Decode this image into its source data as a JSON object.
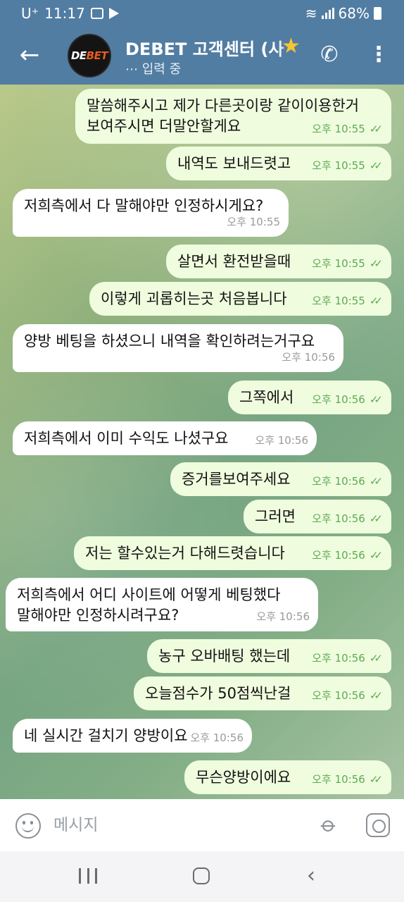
{
  "status_bar": {
    "carrier": "U⁺",
    "time": "11:17",
    "battery": "68%"
  },
  "header": {
    "back_icon": "arrow-left-icon",
    "avatar_text_a": "DE",
    "avatar_text_b": "BET",
    "title": "DEBET 고객센터 (사",
    "subtitle": "⋯ 입력 중",
    "star": "★",
    "call_icon": "phone-icon",
    "more_icon": "more-vertical-icon"
  },
  "messages": [
    {
      "dir": "out",
      "text": "말씀해주시고 제가 다른곳이랑 같이이용한거\n보여주시면 더말안할게요",
      "time": "오후 10:55"
    },
    {
      "dir": "out",
      "text": "내역도 보내드렷고",
      "time": "오후 10:55"
    },
    {
      "dir": "in",
      "text": "저희측에서 다 말해야만 인정하시게요?",
      "time": "오후 10:55"
    },
    {
      "dir": "out",
      "text": "살면서 환전받을때",
      "time": "오후 10:55"
    },
    {
      "dir": "out",
      "text": "이렇게 괴롭히는곳 처음봅니다",
      "time": "오후 10:55"
    },
    {
      "dir": "in",
      "text": "양방 베팅을 하셨으니 내역을 확인하려는거구요",
      "time": "오후 10:56"
    },
    {
      "dir": "out",
      "text": "그쪽에서",
      "time": "오후 10:56"
    },
    {
      "dir": "in",
      "text": "저희측에서 이미 수익도 나셨구요",
      "time": "오후 10:56"
    },
    {
      "dir": "out",
      "text": "증거를보여주세요",
      "time": "오후 10:56"
    },
    {
      "dir": "out",
      "text": "그러면",
      "time": "오후 10:56"
    },
    {
      "dir": "out",
      "text": "저는 할수있는거 다해드렷습니다",
      "time": "오후 10:56"
    },
    {
      "dir": "in",
      "text": "저희측에서 어디 사이트에 어떻게 베팅했다\n말해야만 인정하시려구요?",
      "time": "오후 10:56"
    },
    {
      "dir": "out",
      "text": "농구 오바배팅 했는데",
      "time": "오후 10:56"
    },
    {
      "dir": "out",
      "text": "오늘점수가 50점씩난걸",
      "time": "오후 10:56"
    },
    {
      "dir": "in",
      "text": "네 실시간 걸치기 양방이요",
      "time": "오후 10:56"
    },
    {
      "dir": "out",
      "text": "무슨양방이에요",
      "time": "오후 10:56"
    }
  ],
  "input": {
    "placeholder": "메시지",
    "emoji_icon": "emoji-icon",
    "attach_icon": "paperclip-icon",
    "camera_icon": "camera-icon"
  },
  "colors": {
    "header": "#527da3",
    "outgoing_bubble": "#effdde",
    "incoming_bubble": "#ffffff",
    "read_ticks": "#5ea954"
  }
}
